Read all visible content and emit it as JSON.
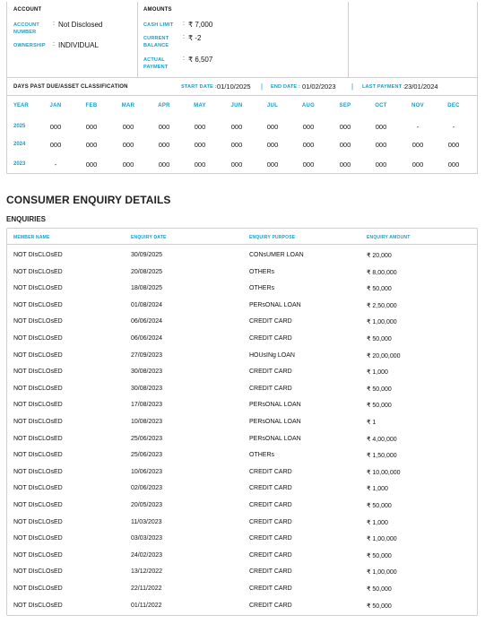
{
  "account_section": {
    "title": "ACCOUNT",
    "fields": [
      {
        "label": "ACCOUNT NUMBER",
        "value": "Not Disclosed"
      },
      {
        "label": "OWNERSHIP",
        "value": "INDIVIDUAL"
      }
    ]
  },
  "amounts_section": {
    "title": "AMOUNTS",
    "fields": [
      {
        "label": "CASH LIMIT",
        "value": "₹ 7,000"
      },
      {
        "label": "CURRENT BALANCE",
        "value": "₹ -2"
      },
      {
        "label": "ACTUAL PAYMENT",
        "value": "₹ 6,507"
      }
    ]
  },
  "dpd": {
    "title": "DAYS PAST DUE/ASSET CLASSIFICATION",
    "start_label": "START DATE :",
    "start_value": "01/10/2025",
    "end_label": "END DATE :",
    "end_value": "01/02/2023",
    "last_payment_label": "LAST PAYMENT :",
    "last_payment_value": "23/01/2024",
    "months": [
      "YEAR",
      "JAN",
      "FEB",
      "MAR",
      "APR",
      "MAY",
      "JUN",
      "JUL",
      "AUG",
      "SEP",
      "OCT",
      "NOV",
      "DEC"
    ],
    "rows": [
      {
        "year": "2025",
        "values": [
          "000",
          "000",
          "000",
          "000",
          "000",
          "000",
          "000",
          "000",
          "000",
          "000",
          "-",
          "-"
        ]
      },
      {
        "year": "2024",
        "values": [
          "000",
          "000",
          "000",
          "000",
          "000",
          "000",
          "000",
          "000",
          "000",
          "000",
          "000",
          "000"
        ]
      },
      {
        "year": "2023",
        "values": [
          "-",
          "000",
          "000",
          "000",
          "000",
          "000",
          "000",
          "000",
          "000",
          "000",
          "000",
          "000"
        ]
      }
    ]
  },
  "enquiry": {
    "heading": "CONSUMER ENQUIRY DETAILS",
    "subheading": "ENQUIRIES",
    "columns": [
      "MEMBER NAME",
      "ENQUIRY DATE",
      "ENQUIRY PURPOSE",
      "ENQUIRY AMOUNT"
    ],
    "rows": [
      [
        "NOT DIsCLOsED",
        "30/09/2025",
        "CONsUMER LOAN",
        "₹ 20,000"
      ],
      [
        "NOT DIsCLOsED",
        "20/08/2025",
        "OTHERs",
        "₹ 8,00,000"
      ],
      [
        "NOT DIsCLOsED",
        "18/08/2025",
        "OTHERs",
        "₹ 50,000"
      ],
      [
        "NOT DIsCLOsED",
        "01/08/2024",
        "PERsONAL LOAN",
        "₹ 2,50,000"
      ],
      [
        "NOT DIsCLOsED",
        "06/06/2024",
        "CREDIT CARD",
        "₹ 1,00,000"
      ],
      [
        "NOT DIsCLOsED",
        "06/06/2024",
        "CREDIT CARD",
        "₹ 50,000"
      ],
      [
        "NOT DIsCLOsED",
        "27/09/2023",
        "HOUsINg LOAN",
        "₹ 20,00,000"
      ],
      [
        "NOT DIsCLOsED",
        "30/08/2023",
        "CREDIT CARD",
        "₹ 1,000"
      ],
      [
        "NOT DIsCLOsED",
        "30/08/2023",
        "CREDIT CARD",
        "₹ 50,000"
      ],
      [
        "NOT DIsCLOsED",
        "17/08/2023",
        "PERsONAL LOAN",
        "₹ 50,000"
      ],
      [
        "NOT DIsCLOsED",
        "10/08/2023",
        "PERsONAL LOAN",
        "₹ 1"
      ],
      [
        "NOT DIsCLOsED",
        "25/06/2023",
        "PERsONAL LOAN",
        "₹ 4,00,000"
      ],
      [
        "NOT DIsCLOsED",
        "25/06/2023",
        "OTHERs",
        "₹ 1,50,000"
      ],
      [
        "NOT DIsCLOsED",
        "10/06/2023",
        "CREDIT CARD",
        "₹ 10,00,000"
      ],
      [
        "NOT DIsCLOsED",
        "02/06/2023",
        "CREDIT CARD",
        "₹ 1,000"
      ],
      [
        "NOT DIsCLOsED",
        "20/05/2023",
        "CREDIT CARD",
        "₹ 50,000"
      ],
      [
        "NOT DIsCLOsED",
        "11/03/2023",
        "CREDIT CARD",
        "₹ 1,000"
      ],
      [
        "NOT DIsCLOsED",
        "03/03/2023",
        "CREDIT CARD",
        "₹ 1,00,000"
      ],
      [
        "NOT DIsCLOsED",
        "24/02/2023",
        "CREDIT CARD",
        "₹ 50,000"
      ],
      [
        "NOT DIsCLOsED",
        "13/12/2022",
        "CREDIT CARD",
        "₹ 1,00,000"
      ],
      [
        "NOT DIsCLOsED",
        "22/11/2022",
        "CREDIT CARD",
        "₹ 50,000"
      ],
      [
        "NOT DIsCLOsED",
        "01/11/2022",
        "CREDIT CARD",
        "₹ 50,000"
      ]
    ]
  }
}
